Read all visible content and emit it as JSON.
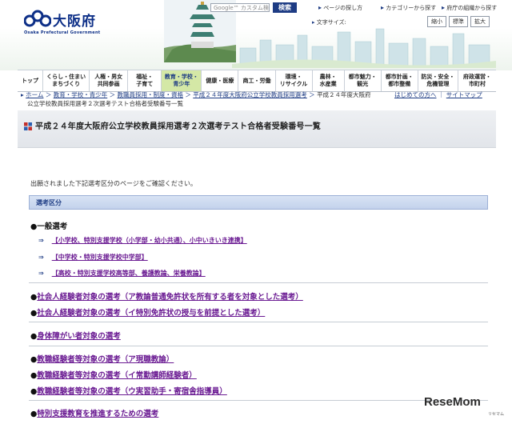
{
  "header": {
    "logo_title": "大阪府",
    "logo_sub": "Osaka Prefectural Government",
    "search_placeholder": "Google™ カスタム検索",
    "search_button": "検索",
    "util_links": [
      "ページの探し方",
      "カテゴリーから探す",
      "府庁の組織から探す"
    ],
    "font_size_label": "文字サイズ:",
    "font_size_buttons": [
      "縮小",
      "標準",
      "拡大"
    ]
  },
  "nav": {
    "items": [
      {
        "label": "トップ",
        "label2": ""
      },
      {
        "label": "くらし・住まい",
        "label2": "まちづくり"
      },
      {
        "label": "人権・男女",
        "label2": "共同参画"
      },
      {
        "label": "福祉・",
        "label2": "子育て"
      },
      {
        "label": "教育・学校・",
        "label2": "青少年"
      },
      {
        "label": "健康・医療",
        "label2": ""
      },
      {
        "label": "商工・労働",
        "label2": ""
      },
      {
        "label": "環境・",
        "label2": "リサイクル"
      },
      {
        "label": "農林・",
        "label2": "水産業"
      },
      {
        "label": "都市魅力・",
        "label2": "観光"
      },
      {
        "label": "都市計画・",
        "label2": "都市整備"
      },
      {
        "label": "防災・安全・",
        "label2": "危機管理"
      },
      {
        "label": "府政運営・",
        "label2": "市町村"
      }
    ]
  },
  "breadcrumb": {
    "home": "ホーム",
    "cat1": "教育・学校・青少年",
    "cat2": "教職員採用・制度・資格",
    "cat3": "平成２４年度大阪府公立学校教員採用選考",
    "current": "平成２４年度大阪府",
    "title_line": "公立学校教員採用選考２次選考テスト合格者受験番号一覧",
    "first_time": "はじめての方へ",
    "sitemap": "サイトマップ"
  },
  "page": {
    "title": "平成２４年度大阪府公立学校教員採用選考２次選考テスト合格者受験番号一覧",
    "intro": "出願されました下記選考区分のページをご確認ください。",
    "section_label": "選考区分",
    "general": "●一般選考",
    "general_subs": [
      "【小学校、特別支援学校（小学部・幼小共通）、小中いきいき連携】",
      "【中学校・特別支援学校中学部】",
      "【高校・特別支援学校高等部、養護教論、栄養教論】"
    ],
    "sub_arrow": "⇒",
    "bullet": "●",
    "items_group1": [
      "社会人経験者対象の選考（ア教論普通免許状を所有する者を対象とした選考）",
      "社会人経験者対象の選考（イ特別免許状の授与を前提とした選考）"
    ],
    "items_group2": [
      "身体障がい者対象の選考"
    ],
    "items_group3": [
      "教職経験者等対象の選考（ア現職教論）",
      "教職経験者等対象の選考（イ常勤講師経験者）",
      "教職経験者等対象の選考（ウ実習助手・寄宿舎指導員）"
    ],
    "items_group4": [
      "特別支援教育を推進するための選考"
    ]
  },
  "watermark": {
    "text": "ReseMom",
    "sub": "リセマム"
  },
  "colors": {
    "brand_blue": "#1e3c84",
    "link_purple": "#6a1a92",
    "nav_active": "#d4e8a6"
  }
}
